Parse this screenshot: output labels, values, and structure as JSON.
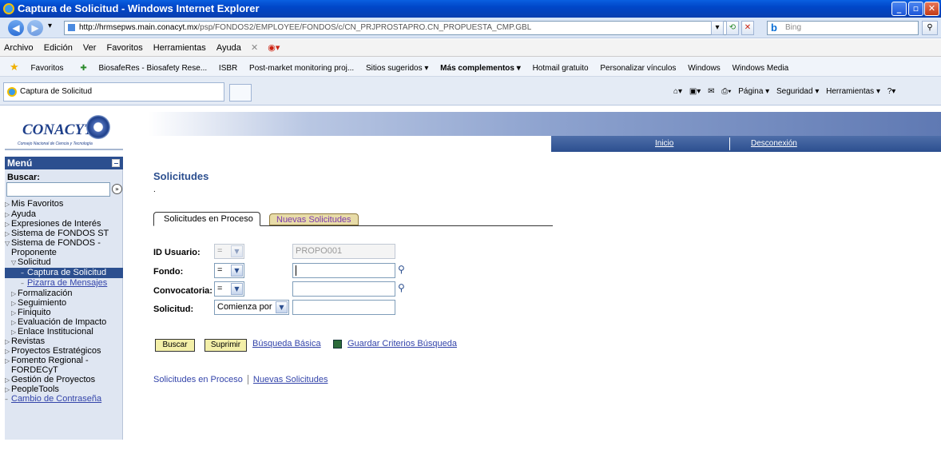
{
  "window": {
    "title": "Captura de Solicitud - Windows Internet Explorer",
    "minimize": "_",
    "maximize": "▫",
    "close": "✕"
  },
  "address": {
    "host": "http://hrmsepws.main.conacyt.mx",
    "path": "/psp/FONDOS2/EMPLOYEE/FONDOS/c/CN_PRJPROSTAPRO.CN_PROPUESTA_CMP.GBL",
    "search_placeholder": "Bing"
  },
  "menubar": [
    "Archivo",
    "Edición",
    "Ver",
    "Favoritos",
    "Herramientas",
    "Ayuda"
  ],
  "favorites": {
    "label": "Favoritos",
    "items": [
      "BiosafeRes - Biosafety Rese...",
      "ISBR",
      "Post-market monitoring proj...",
      "Sitios sugeridos ▾",
      "Más complementos ▾",
      "Hotmail gratuito",
      "Personalizar vínculos",
      "Windows",
      "Windows Media"
    ]
  },
  "tab": {
    "title": "Captura de Solicitud"
  },
  "commandbar": [
    "Página ▾",
    "Seguridad ▾",
    "Herramientas ▾"
  ],
  "header": {
    "logo_text": "CONACYT",
    "logo_sub": "Consejo Nacional de Ciencia y Tecnología",
    "inicio": "Inicio",
    "desconexion": "Desconexión"
  },
  "sidebar": {
    "menu_title": "Menú",
    "search_label": "Buscar:",
    "items": [
      {
        "label": "Mis Favoritos",
        "prefix": "▷"
      },
      {
        "label": "Ayuda",
        "prefix": "▷"
      },
      {
        "label": "Expresiones de Interés",
        "prefix": "▷"
      },
      {
        "label": "Sistema de FONDOS ST",
        "prefix": "▷"
      },
      {
        "label": "Sistema de FONDOS -",
        "prefix": "▽"
      },
      {
        "label": "Proponente",
        "prefix": ""
      },
      {
        "label": "Solicitud",
        "prefix": "▽"
      },
      {
        "label": "Captura de Solicitud",
        "prefix": "–"
      },
      {
        "label": "Pizarra de Mensajes",
        "prefix": "–"
      },
      {
        "label": "Formalización",
        "prefix": "▷"
      },
      {
        "label": "Seguimiento",
        "prefix": "▷"
      },
      {
        "label": "Finiquito",
        "prefix": "▷"
      },
      {
        "label": "Evaluación de Impacto",
        "prefix": "▷"
      },
      {
        "label": "Enlace Institucional",
        "prefix": "▷"
      },
      {
        "label": "Revistas",
        "prefix": "▷"
      },
      {
        "label": "Proyectos Estratégicos",
        "prefix": "▷"
      },
      {
        "label": "Fomento Regional -",
        "prefix": "▷"
      },
      {
        "label": "FORDECyT",
        "prefix": ""
      },
      {
        "label": "Gestión de Proyectos",
        "prefix": "▷"
      },
      {
        "label": "PeopleTools",
        "prefix": "▷"
      },
      {
        "label": "Cambio de Contraseña",
        "prefix": "–"
      }
    ]
  },
  "main": {
    "title": "Solicitudes",
    "dot": ".",
    "tabs": [
      "Solicitudes en Proceso",
      "Nuevas Solicitudes"
    ],
    "fields": {
      "id_usuario": {
        "label": "ID Usuario:",
        "op": "=",
        "value": "PROPO001"
      },
      "fondo": {
        "label": "Fondo:",
        "op": "=",
        "value": ""
      },
      "convocatoria": {
        "label": "Convocatoria:",
        "op": "=",
        "value": ""
      },
      "solicitud": {
        "label": "Solicitud:",
        "op": "Comienza por",
        "value": ""
      }
    },
    "buttons": {
      "buscar": "Buscar",
      "suprimir": "Suprimir",
      "busqueda_basica": "Búsqueda Básica",
      "guardar": "Guardar Criterios Búsqueda"
    },
    "bottom_links": [
      "Solicitudes en Proceso",
      "Nuevas Solicitudes"
    ]
  }
}
